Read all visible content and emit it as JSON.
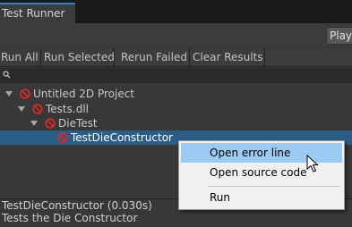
{
  "window": {
    "tab_label": "Test Runner",
    "play_label": "Play"
  },
  "toolbar": {
    "buttons": [
      "Run All",
      "Run Selected",
      "Rerun Failed",
      "Clear Results"
    ]
  },
  "search": {
    "value": "",
    "placeholder": ""
  },
  "tree": {
    "items": [
      {
        "label": "Untitled 2D Project",
        "status": "failed",
        "expanded": true,
        "depth": 0
      },
      {
        "label": "Tests.dll",
        "status": "failed",
        "expanded": true,
        "depth": 1
      },
      {
        "label": "DieTest",
        "status": "failed",
        "expanded": true,
        "depth": 2
      },
      {
        "label": "TestDieConstructor",
        "status": "failed",
        "selected": true,
        "depth": 3
      }
    ]
  },
  "details": {
    "title": "TestDieConstructor (0.030s)",
    "description": "Tests the Die Constructor"
  },
  "context_menu": {
    "items": [
      "Open error line",
      "Open source code",
      "Run"
    ],
    "hovered": "Open error line"
  },
  "colors": {
    "fail_icon": "#e02727",
    "selection": "#2c5d87",
    "menu_hover": "#9bcbf2",
    "tab_accent": "#3a79bb"
  }
}
